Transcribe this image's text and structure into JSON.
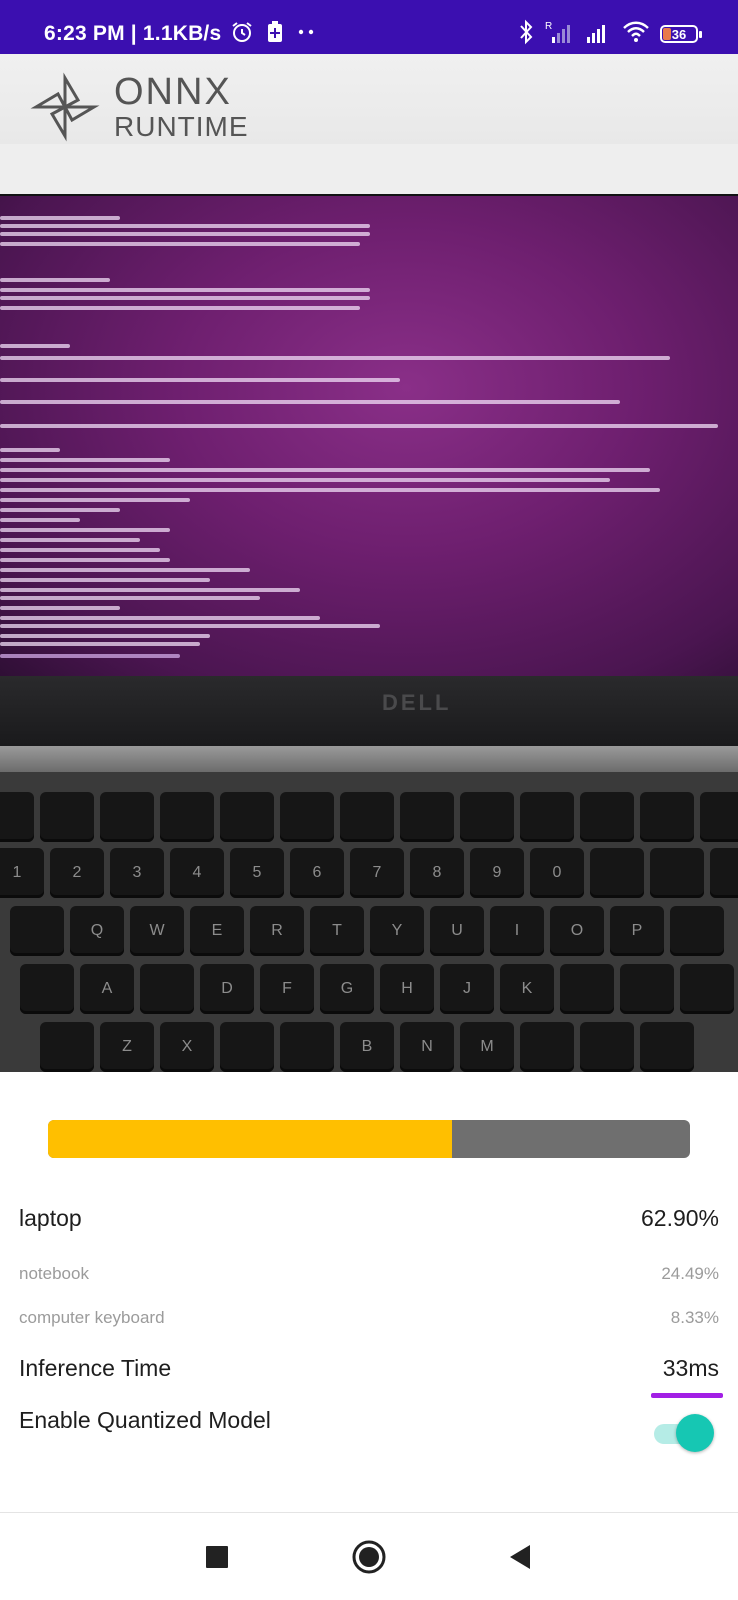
{
  "status_bar": {
    "time": "6:23 PM | 1.1KB/s",
    "battery": "36",
    "background": "#3b0fb0"
  },
  "camera_preview": {
    "logo_text": [
      "ONNX",
      "RUNTIME"
    ],
    "laptop_brand": "DELL"
  },
  "progress": {
    "value": 0.629,
    "fill_color": "#ffbf00",
    "track_color": "#6f6f6f"
  },
  "results": [
    {
      "label": "laptop",
      "score": "62.90%"
    },
    {
      "label": "notebook",
      "score": "24.49%"
    },
    {
      "label": "computer keyboard",
      "score": "8.33%"
    }
  ],
  "inference": {
    "label": "Inference Time",
    "value": "33ms",
    "accent": "#a21fe5"
  },
  "quantized": {
    "label": "Enable Quantized Model",
    "enabled": true,
    "accent": "#16c7b3"
  },
  "navigation": {
    "buttons": [
      "recents-button",
      "home-button",
      "back-button"
    ]
  }
}
